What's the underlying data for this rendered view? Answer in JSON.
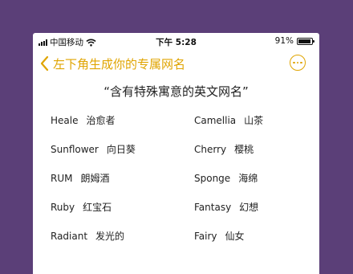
{
  "status_bar": {
    "carrier": "中国移动",
    "time": "下午 5:28",
    "battery_text": "91%",
    "battery_level": 0.91
  },
  "nav": {
    "title": "左下角生成你的专属网名",
    "accent_color": "#e0a400",
    "back_icon": "chevron-left-icon",
    "more_icon": "more-horizontal-icon"
  },
  "heading": "“含有特殊寓意的英文网名”",
  "names": {
    "left": [
      {
        "en": "Heale",
        "zh": "治愈者"
      },
      {
        "en": "Sunflower",
        "zh": "向日葵"
      },
      {
        "en": "RUM",
        "zh": "朗姆酒"
      },
      {
        "en": "Ruby",
        "zh": "红宝石"
      },
      {
        "en": "Radiant",
        "zh": "发光的"
      }
    ],
    "right": [
      {
        "en": "Camellia",
        "zh": "山茶"
      },
      {
        "en": "Cherry",
        "zh": "樱桃"
      },
      {
        "en": "Sponge",
        "zh": "海绵"
      },
      {
        "en": "Fantasy",
        "zh": "幻想"
      },
      {
        "en": "Fairy",
        "zh": "仙女"
      }
    ]
  }
}
